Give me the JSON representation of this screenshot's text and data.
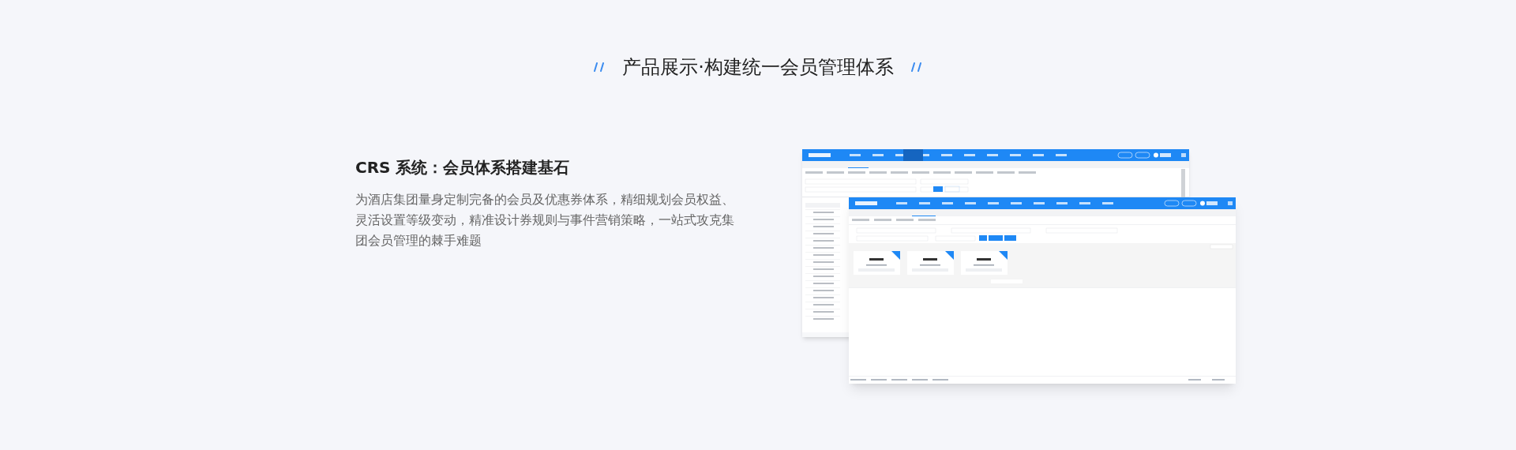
{
  "section_title": "产品展示·构建统一会员管理体系",
  "feature": {
    "heading": "CRS 系统：会员体系搭建基石",
    "description": "为酒店集团量身定制完备的会员及优惠券体系，精细规划会员权益、灵活设置等级变动，精准设计券规则与事件营销策略，一站式攻克集团会员管理的棘手难题"
  }
}
